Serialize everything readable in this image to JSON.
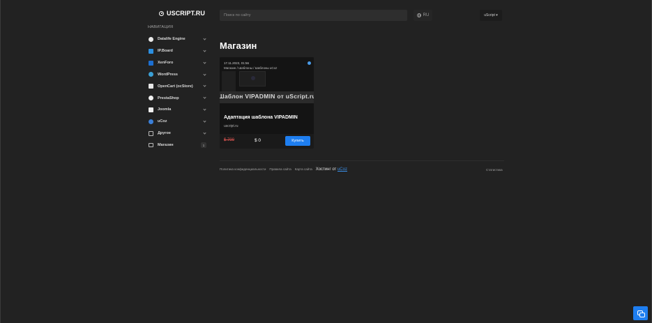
{
  "header": {
    "logo_text": "USCRIPT.RU",
    "search_placeholder": "Поиск по сайту",
    "language": "RU",
    "user_menu": "uScript ▾"
  },
  "sidebar": {
    "heading": "НАВИГАЦИЯ",
    "items": [
      {
        "label": "Datalife Engine",
        "icon": "datalife-engine-icon"
      },
      {
        "label": "IP.Board",
        "icon": "ipboard-icon"
      },
      {
        "label": "XenForo",
        "icon": "xenforo-icon"
      },
      {
        "label": "WordPress",
        "icon": "wordpress-icon"
      },
      {
        "label": "OpenCart (ocStore)",
        "icon": "opencart-icon"
      },
      {
        "label": "PrestaShop",
        "icon": "prestashop-icon"
      },
      {
        "label": "Joomla",
        "icon": "joomla-icon"
      },
      {
        "label": "uCoz",
        "icon": "ucoz-icon"
      },
      {
        "label": "Другое",
        "icon": "box-icon"
      },
      {
        "label": "Магазин",
        "icon": "shopping-bag-icon",
        "badge": "1"
      }
    ]
  },
  "main": {
    "title": "Магазин",
    "product": {
      "date": "17.11.2023, 01:56",
      "breadcrumb": "Магазин / Шаблоны / Шаблоны uCoz",
      "banner": "Шаблон VIPADMIN от uScript.ru",
      "title": "Адаптация шаблона VIPADMIN",
      "author": "uscript.ru",
      "old_price": "$ 700",
      "new_price": "$ 0",
      "buy_label": "Купить"
    }
  },
  "footer": {
    "privacy": "Политика конфиденциальности",
    "rules": "Правила сайта",
    "sitemap": "Карта сайта",
    "hosting_prefix": "Хостинг от",
    "hosting_link": "uCoz",
    "stats": "Статистика"
  },
  "colors": {
    "background": "#222222",
    "accent": "#1e7ef0",
    "old_price": "#d9534f"
  }
}
